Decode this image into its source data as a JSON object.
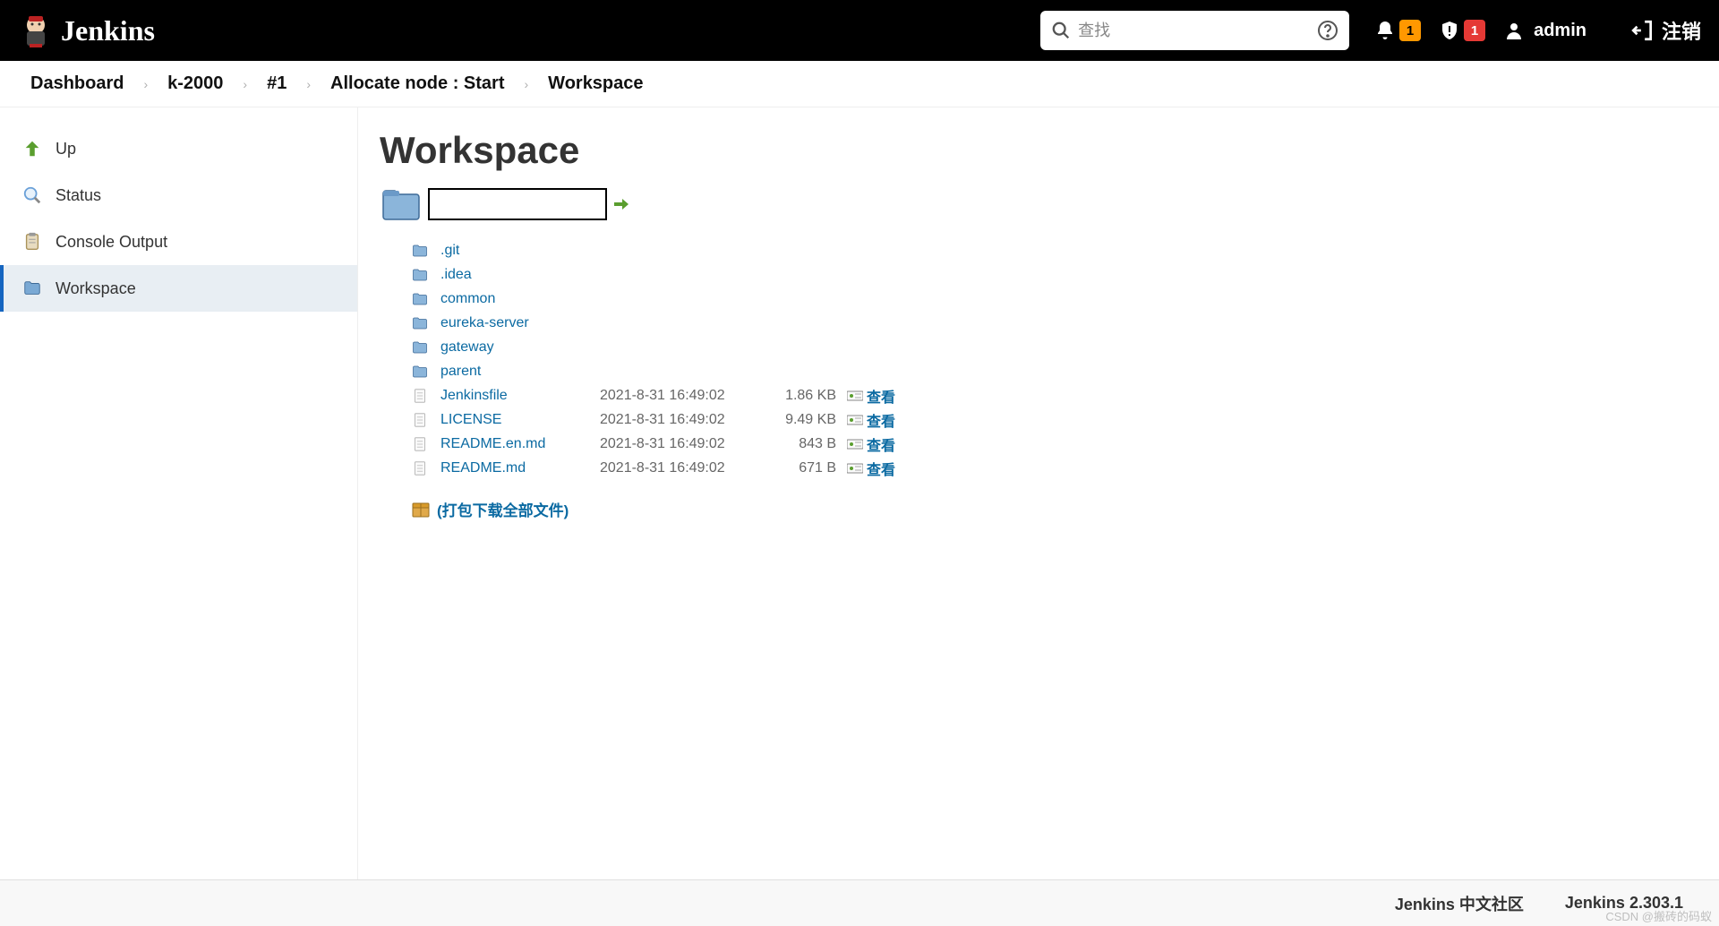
{
  "header": {
    "brand": "Jenkins",
    "search_placeholder": "查找",
    "notif_count": "1",
    "alert_count": "1",
    "username": "admin",
    "logout_label": "注销"
  },
  "breadcrumbs": [
    "Dashboard",
    "k-2000",
    "#1",
    "Allocate node : Start",
    "Workspace"
  ],
  "sidebar": {
    "items": [
      {
        "label": "Up",
        "icon": "arrow-up"
      },
      {
        "label": "Status",
        "icon": "magnifier"
      },
      {
        "label": "Console Output",
        "icon": "clipboard"
      },
      {
        "label": "Workspace",
        "icon": "folder",
        "active": true
      }
    ]
  },
  "main": {
    "title": "Workspace",
    "entries": [
      {
        "type": "dir",
        "name": ".git"
      },
      {
        "type": "dir",
        "name": ".idea"
      },
      {
        "type": "dir",
        "name": "common"
      },
      {
        "type": "dir",
        "name": "eureka-server"
      },
      {
        "type": "dir",
        "name": "gateway"
      },
      {
        "type": "dir",
        "name": "parent"
      },
      {
        "type": "file",
        "name": "Jenkinsfile",
        "date": "2021-8-31 16:49:02",
        "size": "1.86 KB",
        "view": "查看"
      },
      {
        "type": "file",
        "name": "LICENSE",
        "date": "2021-8-31 16:49:02",
        "size": "9.49 KB",
        "view": "查看"
      },
      {
        "type": "file",
        "name": "README.en.md",
        "date": "2021-8-31 16:49:02",
        "size": "843 B",
        "view": "查看"
      },
      {
        "type": "file",
        "name": "README.md",
        "date": "2021-8-31 16:49:02",
        "size": "671 B",
        "view": "查看"
      }
    ],
    "download_all": "(打包下载全部文件)"
  },
  "footer": {
    "community": "Jenkins 中文社区",
    "version": "Jenkins 2.303.1",
    "watermark": "CSDN @搬砖的码蚁"
  }
}
